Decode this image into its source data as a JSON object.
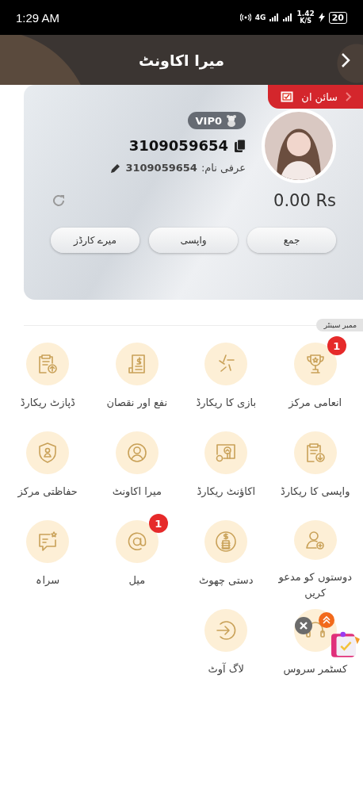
{
  "status_bar": {
    "time": "1:29 AM",
    "network": "4G",
    "speed": "1.42",
    "speed_unit": "K/S",
    "battery": "20"
  },
  "header": {
    "title": "میرا اکاونٹ"
  },
  "card": {
    "sign_in": "سائن ان",
    "vip": "VIP0",
    "uid": "3109059654",
    "nickname_label": "عرفی نام:",
    "nickname": "3109059654",
    "balance": "0.00 Rs",
    "buttons": [
      "جمع",
      "واپسی",
      "میرے کارڈز"
    ]
  },
  "section": {
    "title": "ممبر سینٹر"
  },
  "items": [
    {
      "label": "انعامی مرکز",
      "badge": "1"
    },
    {
      "label": "بازی کا ریکارڈ"
    },
    {
      "label": "نفع اور نقصان"
    },
    {
      "label": "ڈپازٹ ریکارڈ"
    },
    {
      "label": "واپسی کا ریکارڈ"
    },
    {
      "label": "اکاؤنٹ ریکارڈ"
    },
    {
      "label": "میرا اکاونٹ"
    },
    {
      "label": "حفاظتی مرکز"
    },
    {
      "label": "دوستوں کو مدعو کریں"
    },
    {
      "label": "دستی چھوٹ"
    },
    {
      "label": "میل",
      "badge": "1"
    },
    {
      "label": "سراہ"
    },
    {
      "label": "کسٹمر سروس"
    },
    {
      "label": "لاگ آوٹ"
    }
  ]
}
